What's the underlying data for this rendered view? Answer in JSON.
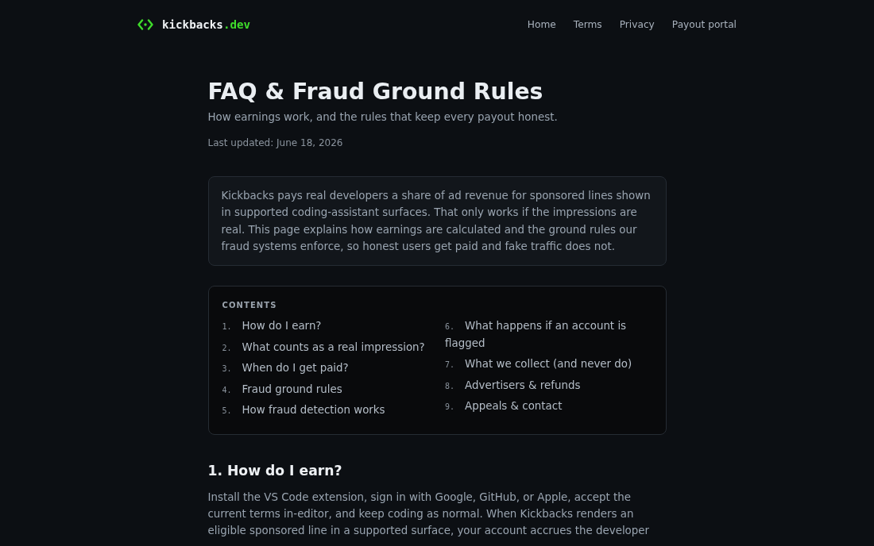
{
  "header": {
    "logo": {
      "name": "kickbacks",
      "tld": ".dev"
    },
    "nav": [
      {
        "label": "Home"
      },
      {
        "label": "Terms"
      },
      {
        "label": "Privacy"
      },
      {
        "label": "Payout portal"
      }
    ]
  },
  "page": {
    "title": "FAQ & Fraud Ground Rules",
    "subtitle": "How earnings work, and the rules that keep every payout honest.",
    "updated": "Last updated: June 18, 2026"
  },
  "intro": "Kickbacks pays real developers a share of ad revenue for sponsored lines shown in supported coding-assistant surfaces. That only works if the impressions are real. This page explains how earnings are calculated and the ground rules our fraud systems enforce, so honest users get paid and fake traffic does not.",
  "contents": {
    "heading": "CONTENTS",
    "items": [
      {
        "number": "1.",
        "label": "How do I earn?"
      },
      {
        "number": "2.",
        "label": "What counts as a real impression?"
      },
      {
        "number": "3.",
        "label": "When do I get paid?"
      },
      {
        "number": "4.",
        "label": "Fraud ground rules"
      },
      {
        "number": "5.",
        "label": "How fraud detection works"
      },
      {
        "number": "6.",
        "label": "What happens if an account is flagged"
      },
      {
        "number": "7.",
        "label": "What we collect (and never do)"
      },
      {
        "number": "8.",
        "label": "Advertisers & refunds"
      },
      {
        "number": "9.",
        "label": "Appeals & contact"
      }
    ]
  },
  "sections": [
    {
      "heading": "1. How do I earn?",
      "body": "Install the VS Code extension, sign in with Google, GitHub, or Apple, accept the current terms in-editor, and keep coding as normal. When Kickbacks renders an eligible sponsored line in a supported surface, your account accrues the developer"
    }
  ]
}
